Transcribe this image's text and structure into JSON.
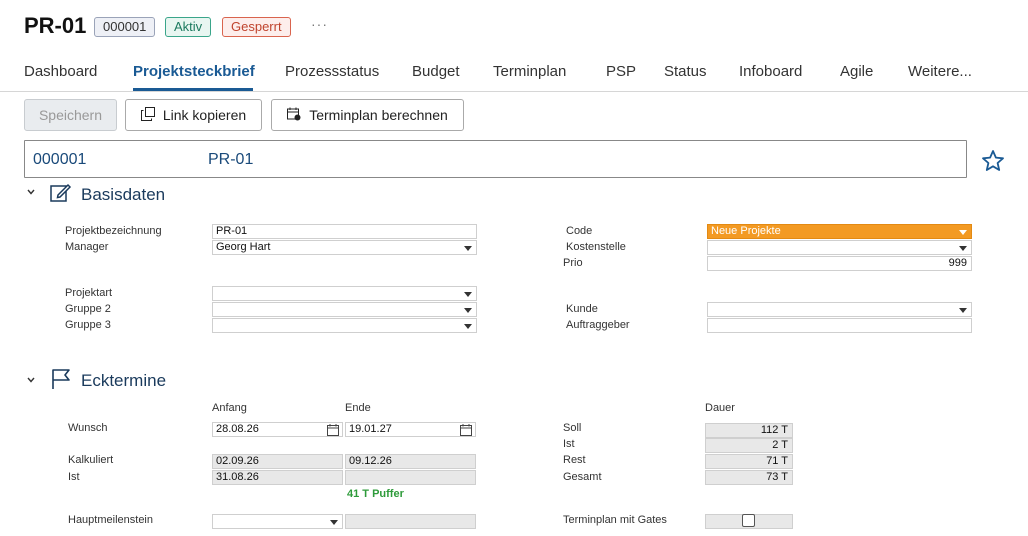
{
  "header": {
    "title": "PR-01",
    "badges": {
      "id": "000001",
      "status": "Aktiv",
      "lock": "Gesperrt"
    },
    "more": "···"
  },
  "tabs": [
    "Dashboard",
    "Projektsteckbrief",
    "Prozessstatus",
    "Budget",
    "Terminplan",
    "PSP",
    "Status",
    "Infoboard",
    "Agile",
    "Weitere..."
  ],
  "active_tab": "Projektsteckbrief",
  "toolbar": {
    "save": "Speichern",
    "copy_link": "Link kopieren",
    "calc_schedule": "Terminplan berechnen"
  },
  "idbar": {
    "number": "000001",
    "name": "PR-01"
  },
  "basisdaten": {
    "title": "Basisdaten",
    "projektbezeichnung_label": "Projektbezeichnung",
    "projektbezeichnung": "PR-01",
    "manager_label": "Manager",
    "manager": "Georg Hart",
    "code_label": "Code",
    "code": "Neue Projekte",
    "kostenstelle_label": "Kostenstelle",
    "kostenstelle": "",
    "prio_label": "Prio",
    "prio": "999",
    "projektart_label": "Projektart",
    "gruppe2_label": "Gruppe 2",
    "gruppe3_label": "Gruppe 3",
    "kunde_label": "Kunde",
    "auftraggeber_label": "Auftraggeber"
  },
  "ecktermine": {
    "title": "Ecktermine",
    "anfang_label": "Anfang",
    "ende_label": "Ende",
    "dauer_label": "Dauer",
    "wunsch_label": "Wunsch",
    "wunsch_anfang": "28.08.26",
    "wunsch_ende": "19.01.27",
    "kalkuliert_label": "Kalkuliert",
    "kalk_anfang": "02.09.26",
    "kalk_ende": "09.12.26",
    "ist_label": "Ist",
    "ist_anfang": "31.08.26",
    "ist_ende": "",
    "puffer": "41 T Puffer",
    "soll_label": "Soll",
    "soll": "112 T",
    "ist2_label": "Ist",
    "ist_dauer": "2 T",
    "rest_label": "Rest",
    "rest": "71 T",
    "gesamt_label": "Gesamt",
    "gesamt": "73 T",
    "hauptmeilenstein_label": "Hauptmeilenstein",
    "gates_label": "Terminplan mit Gates",
    "gates_checked": false
  },
  "colors": {
    "accent": "#1a5a94",
    "code_orange": "#f39a23",
    "puffer_green": "#2e9b3a"
  }
}
